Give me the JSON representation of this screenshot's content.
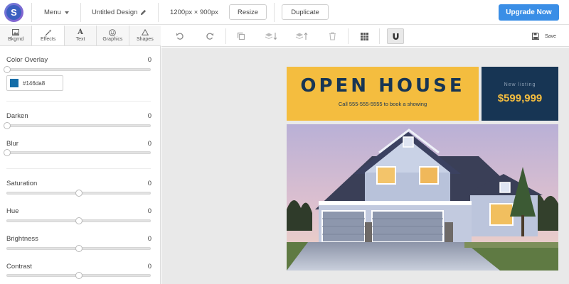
{
  "topbar": {
    "logo_letter": "S",
    "menu_label": "Menu",
    "design_title": "Untitled Design",
    "dimensions": "1200px × 900px",
    "resize_label": "Resize",
    "duplicate_label": "Duplicate",
    "upgrade_label": "Upgrade Now"
  },
  "tabs": [
    {
      "label": "Bkgrnd",
      "icon": "image-icon",
      "active": false
    },
    {
      "label": "Effects",
      "icon": "magic-wand-icon",
      "active": true
    },
    {
      "label": "Text",
      "icon": "text-icon",
      "active": false
    },
    {
      "label": "Graphics",
      "icon": "smiley-icon",
      "active": false
    },
    {
      "label": "Shapes",
      "icon": "triangle-icon",
      "active": false
    }
  ],
  "effects": {
    "color_overlay": {
      "label": "Color Overlay",
      "value": "0",
      "level": 0,
      "color_hex": "#146da8"
    },
    "darken": {
      "label": "Darken",
      "value": "0",
      "level": 0
    },
    "blur": {
      "label": "Blur",
      "value": "0",
      "level": 0
    },
    "saturation": {
      "label": "Saturation",
      "value": "0",
      "level": 0.5
    },
    "hue": {
      "label": "Hue",
      "value": "0",
      "level": 0.5
    },
    "brightness": {
      "label": "Brightness",
      "value": "0",
      "level": 0.5
    },
    "contrast": {
      "label": "Contrast",
      "value": "0",
      "level": 0.5
    }
  },
  "toolbar": {
    "icons": [
      "undo-icon",
      "redo-icon",
      "duplicate-icon",
      "send-backward-icon",
      "bring-forward-icon",
      "trash-icon",
      "grid-icon",
      "magnet-icon"
    ],
    "save_label": "Save"
  },
  "design": {
    "headline": "OPEN HOUSE",
    "subline": "Call 555-555-5555 to book a showing",
    "listing_label": "New listing",
    "price": "$599,999"
  },
  "colors": {
    "accent": "#3a8ee6",
    "headline_bg": "#f4bd3f",
    "navy": "#173554",
    "overlay": "#146da8"
  }
}
